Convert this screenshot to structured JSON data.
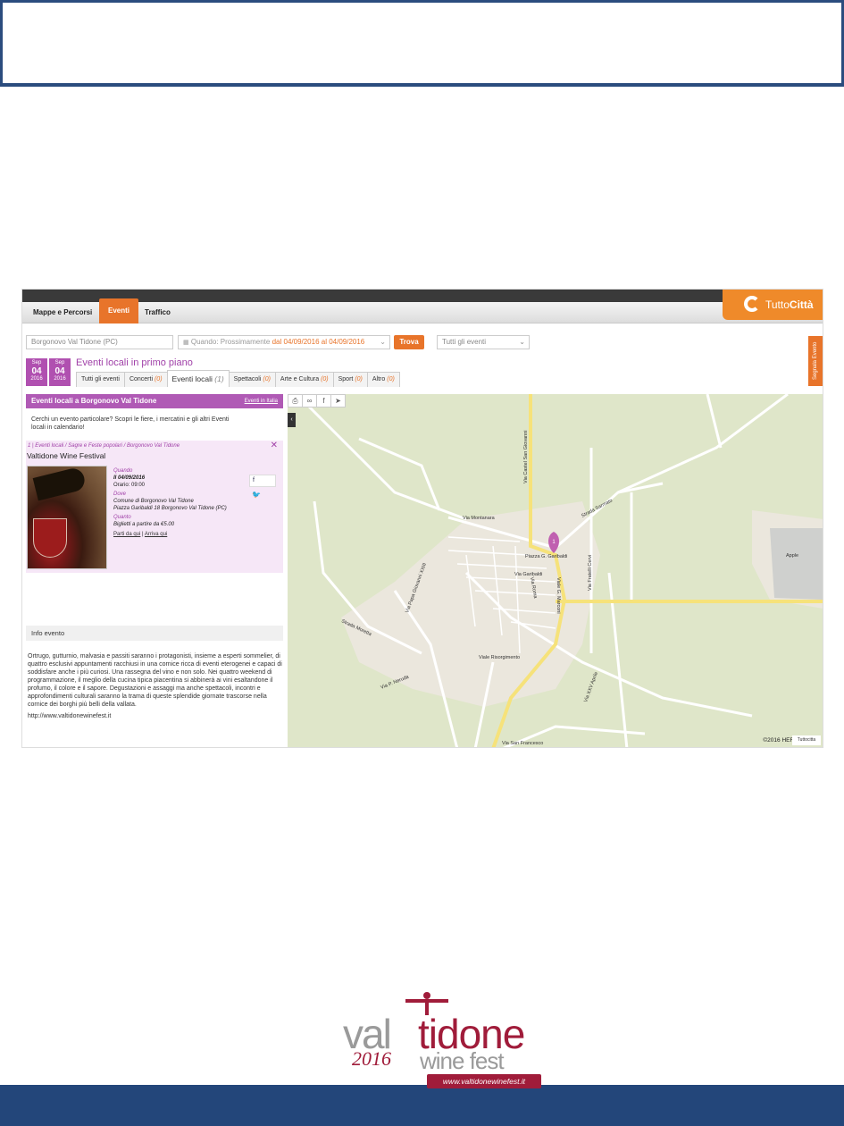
{
  "navbar": {
    "items": [
      "Mappe e Percorsi",
      "Eventi",
      "Traffico"
    ],
    "logo_prefix": "Tutto",
    "logo_suffix": "Città"
  },
  "search": {
    "location": "Borgonovo Val Tidone (PC)",
    "when_label": "Quando: Prossimamente",
    "when_range": "dal 04/09/2016 al 04/09/2016",
    "find_button": "Trova",
    "category": "Tutti gli eventi",
    "report_button": "Segnala Evento"
  },
  "dates": [
    {
      "month": "Sep",
      "day": "04",
      "year": "2016"
    },
    {
      "month": "Sep",
      "day": "04",
      "year": "2016"
    }
  ],
  "section_title": "Eventi locali in primo piano",
  "tabs": [
    {
      "label": "Tutti gli eventi",
      "count": ""
    },
    {
      "label": "Concerti",
      "count": "(0)"
    },
    {
      "label": "Eventi locali",
      "count": "(1)"
    },
    {
      "label": "Spettacoli",
      "count": "(0)"
    },
    {
      "label": "Arte e Cultura",
      "count": "(0)"
    },
    {
      "label": "Sport",
      "count": "(0)"
    },
    {
      "label": "Altro",
      "count": "(0)"
    }
  ],
  "left_panel": {
    "header": "Eventi locali a Borgonovo Val Tidone",
    "header_link": "Eventi in Italia",
    "intro": "Cerchi un evento particolare? Scopri le fiere, i mercatini e gli altri Eventi locali in calendario!",
    "event": {
      "crumb": "1  |  Eventi locali / Sagre e Feste popolari / Borgonovo Val Tidone",
      "name": "Valtidone Wine Festival",
      "when_label": "Quando",
      "date": "Il 04/09/2016",
      "time": "Orario: 09:00",
      "where_label": "Dove",
      "place": "Comune di Borgonovo Val Tidone",
      "address": "Piazza Garibaldi 18 Borgonovo Val Tidone (PC)",
      "price_label": "Quanto",
      "price": "Biglietti a partire da €5.00",
      "link_from": "Parti da qui",
      "link_to": "Arriva qui"
    },
    "info_title": "Info evento",
    "info_text": "Ortrugo, gutturnio, malvasia e passiti saranno i protagonisti, insieme a esperti sommelier, di quattro esclusivi appuntamenti racchiusi in una cornice ricca di eventi eterogenei e capaci di soddisfare anche i più curiosi. Una rassegna del vino e non solo. Nei quattro weekend di programmazione, il meglio della cucina tipica piacentina si abbinerà ai vini esaltandone il profumo, il colore e il sapore. Degustazioni e assaggi ma anche spettacoli, incontri e approfondimenti culturali saranno la trama di queste splendide giornate trascorse nella cornice dei borghi più belli della vallata.",
    "info_url": "http://www.valtidonewinefest.it"
  },
  "map": {
    "marker": "1",
    "copyright": "©2016 HERE |",
    "streets": [
      "Via Montanara",
      "Strada Sarmato",
      "Via Castel San Giovanni",
      "Piazza G. Garibaldi",
      "Via Garibaldi",
      "Viale G. Marconi",
      "Via Fratelli Cervi",
      "Via Roma",
      "Viale Risorgimento",
      "Strada Moretta",
      "Via P. Neruda",
      "Via San Francesco",
      "Apple",
      "Via Papa Giovanni XXIII",
      "Via XXV Aprile"
    ],
    "here_badge": "Tuttocitta",
    "colors": {
      "land": "#dfe6c9",
      "town": "#eae6dc",
      "road": "#ffffff",
      "main_road": "#f6e27a",
      "marker": "#c060b0"
    }
  },
  "footer_logo": {
    "part1": "val",
    "part2": "tidone",
    "year": "2016",
    "winefest": "wine fest",
    "url": "www.valtidonewinefest.it"
  }
}
